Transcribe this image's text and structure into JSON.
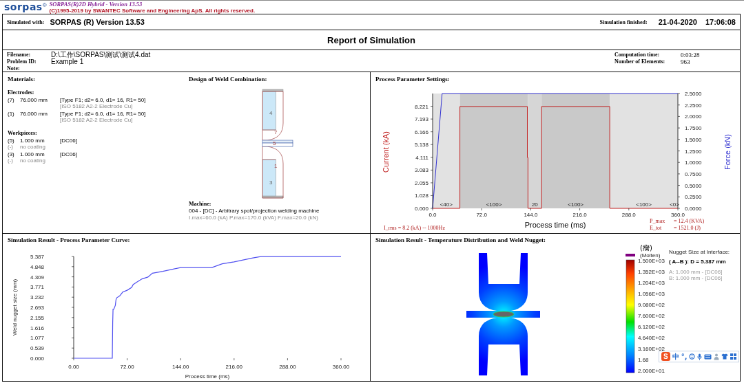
{
  "header": {
    "logo": "sorpas",
    "logo_mark": "®",
    "product": "SORPAS(R)2D Hybrid - Version 13.53",
    "copyright": "(C)1995-2019 by SWANTEC Software and Engineering ApS. All rights reserved."
  },
  "run": {
    "simulated_with_label": "Simulated with:",
    "simulated_with": "SORPAS (R) Version 13.53",
    "finished_label": "Simulation finished:",
    "finished_date": "21-04-2020",
    "finished_time": "17:06:08"
  },
  "title": "Report of Simulation",
  "info_left": [
    {
      "label": "Filename:",
      "value": "D:\\工作\\SORPAS\\测试\\测试4.dat"
    },
    {
      "label": "Problem ID:",
      "value": "Example 1"
    },
    {
      "label": "Note:"
    }
  ],
  "info_right": [
    {
      "label": "Computation time:",
      "value": "0:03:28"
    },
    {
      "label": "Number of Elements:",
      "value": "963"
    }
  ],
  "materials": {
    "title": "Materials:",
    "electrodes_title": "Electrodes:",
    "electrodes": [
      {
        "id": "(7)",
        "size": "76.000 mm",
        "spec": "[Type F1;  d2= 6.0,  d1= 16,  R1= 50]",
        "material": "[ISO 5182   A2-2 Electrode Cu]"
      },
      {
        "id": "(1)",
        "size": "76.000 mm",
        "spec": "[Type F1;  d2= 6.0,  d1= 16,  R1= 50]",
        "material": "[ISO 5182   A2-2 Electrode Cu]"
      }
    ],
    "workpieces_title": "Workpieces:",
    "workpieces": [
      {
        "id": "(5)",
        "size": "1.000 mm",
        "spec": "[DC06]",
        "coating_id": "(-)",
        "coating": "no coating"
      },
      {
        "id": "(3)",
        "size": "1.000 mm",
        "spec": "[DC06]",
        "coating_id": "(-)",
        "coating": "no coating"
      }
    ]
  },
  "design": {
    "title": "Design of Weld Combination:",
    "labels": [
      "4",
      "7",
      "5",
      "1",
      "3"
    ],
    "machine_title": "Machine:",
    "machine": "004 - [DC] - Arbitrary spot/projection welding machine",
    "machine_limits": "I.max=60.0 (kA)  P.max=170.0 (kVA)  F.max=20.0 (kN)"
  },
  "process": {
    "title": "Process Parameter Settings:",
    "chart_data": {
      "type": "line",
      "xlabel": "Process time (ms)",
      "ylabel": "Current  (kA)",
      "y2label": "Force (kN)",
      "xlim": [
        0,
        360
      ],
      "ylim": [
        0,
        9.249
      ],
      "y2lim": [
        0,
        2.5
      ],
      "xticks": [
        {
          "value": 0,
          "label": "0.0"
        },
        {
          "value": 72,
          "label": "72.0"
        },
        {
          "value": 144,
          "label": "144.0"
        },
        {
          "value": 216,
          "label": "216.0"
        },
        {
          "value": 288,
          "label": "288.0"
        },
        {
          "value": 360,
          "label": "360.0"
        }
      ],
      "yticks": [
        {
          "value": 0,
          "label": "0.000"
        },
        {
          "value": 1.028,
          "label": "1.028"
        },
        {
          "value": 2.055,
          "label": "2.055"
        },
        {
          "value": 3.083,
          "label": "3.083"
        },
        {
          "value": 4.111,
          "label": "4.111"
        },
        {
          "value": 5.138,
          "label": "5.138"
        },
        {
          "value": 6.166,
          "label": "6.166"
        },
        {
          "value": 7.193,
          "label": "7.193"
        },
        {
          "value": 8.221,
          "label": "8.221"
        }
      ],
      "y2ticks": [
        {
          "value": 0,
          "label": "0.0000"
        },
        {
          "value": 0.25,
          "label": "0.2500"
        },
        {
          "value": 0.5,
          "label": "0.5000"
        },
        {
          "value": 0.75,
          "label": "0.7500"
        },
        {
          "value": 1,
          "label": "1.0000"
        },
        {
          "value": 1.25,
          "label": "1.2500"
        },
        {
          "value": 1.5,
          "label": "1.5000"
        },
        {
          "value": 1.75,
          "label": "1.7500"
        },
        {
          "value": 2,
          "label": "2.0000"
        },
        {
          "value": 2.25,
          "label": "2.2500"
        },
        {
          "value": 2.5,
          "label": "2.5000"
        }
      ],
      "series": [
        {
          "color": "#c02020",
          "x": [
            0,
            40,
            40,
            139,
            139,
            140,
            140,
            160,
            160,
            260,
            260,
            360
          ],
          "values": [
            0,
            0,
            8.2,
            8.2,
            4.1,
            4.1,
            0,
            0,
            8.2,
            8.2,
            0,
            0
          ]
        },
        {
          "color": "#3030d0",
          "axis": "y2",
          "x": [
            0,
            14,
            360
          ],
          "values": [
            0,
            2.5,
            2.5
          ]
        }
      ],
      "bands": [
        {
          "axis": "x",
          "from": 0,
          "to": 40,
          "color": "#e2e2e2"
        },
        {
          "axis": "x",
          "from": 40,
          "to": 140,
          "color": "#c9c9c9"
        },
        {
          "axis": "x",
          "from": 140,
          "to": 160,
          "color": "#d6d6d6"
        },
        {
          "axis": "x",
          "from": 160,
          "to": 260,
          "color": "#c9c9c9"
        },
        {
          "axis": "x",
          "from": 260,
          "to": 360,
          "color": "#e2e2e2"
        }
      ],
      "annotations": [
        "<40>",
        "<100>",
        "20",
        "<100>",
        "<100>",
        "<0>"
      ]
    },
    "irms": "I_rms = 8.2 (kA)  -- 1000Hz",
    "stats": [
      {
        "label": "P_max",
        "value": "= 12.4 (KVA)"
      },
      {
        "label": "E_tot",
        "value": "= 1521.0 (J)"
      }
    ]
  },
  "curve": {
    "title": "Simulation Result - Process Parameter Curve:",
    "chart_data": {
      "type": "line",
      "xlabel": "Process time (ms)",
      "ylabel": "Weld nugget size  (mm)",
      "xlim": [
        0,
        360
      ],
      "ylim": [
        0,
        5.387
      ],
      "xticks": [
        {
          "value": 0,
          "label": "0.00"
        },
        {
          "value": 72,
          "label": "72.00"
        },
        {
          "value": 144,
          "label": "144.00"
        },
        {
          "value": 216,
          "label": "216.00"
        },
        {
          "value": 288,
          "label": "288.00"
        },
        {
          "value": 360,
          "label": "360.00"
        }
      ],
      "yticks": [
        {
          "value": 0,
          "label": "0.000"
        },
        {
          "value": 0.539,
          "label": "0.539"
        },
        {
          "value": 1.077,
          "label": "1.077"
        },
        {
          "value": 1.616,
          "label": "1.616"
        },
        {
          "value": 2.155,
          "label": "2.155"
        },
        {
          "value": 2.693,
          "label": "2.693"
        },
        {
          "value": 3.232,
          "label": "3.232"
        },
        {
          "value": 3.771,
          "label": "3.771"
        },
        {
          "value": 4.309,
          "label": "4.309"
        },
        {
          "value": 4.848,
          "label": "4.848"
        },
        {
          "value": 5.387,
          "label": "5.387"
        }
      ],
      "x": [
        0,
        52,
        52.5,
        53,
        54,
        56,
        57,
        58,
        62,
        66,
        72,
        78,
        80,
        84,
        92,
        100,
        106,
        120,
        144,
        168,
        186,
        200,
        216,
        240,
        252,
        360
      ],
      "series": [
        {
          "color": "#5050f0",
          "values": [
            0,
            0,
            1.9,
            2.6,
            2.6,
            2.8,
            3.1,
            3.2,
            3.3,
            3.5,
            3.6,
            3.75,
            3.9,
            4.0,
            4.2,
            4.3,
            4.5,
            4.6,
            4.8,
            4.8,
            4.8,
            5.0,
            5.1,
            5.3,
            5.38,
            5.38
          ]
        }
      ]
    }
  },
  "temperature": {
    "title": "Simulation Result - Temperature Distribution and Weld Nugget:",
    "unit": "(癵)",
    "molten": "(Molten)",
    "scale": [
      "1.500E+03",
      "1.352E+03",
      "1.204E+03",
      "1.056E+03",
      "9.080E+02",
      "7.600E+02",
      "6.120E+02",
      "4.640E+02",
      "3.160E+02",
      "1.68",
      "2.000E+01"
    ],
    "nugget_title": "Nugget Size at Interface:",
    "nugget_result": "( A--B ):  D = 5.387  mm",
    "layers": [
      "A: 1.000 mm - [DC06]",
      "B: 1.000 mm - [DC06]"
    ]
  },
  "ime_toolbar": {
    "logo": "S",
    "items": [
      "中",
      "°,"
    ]
  }
}
